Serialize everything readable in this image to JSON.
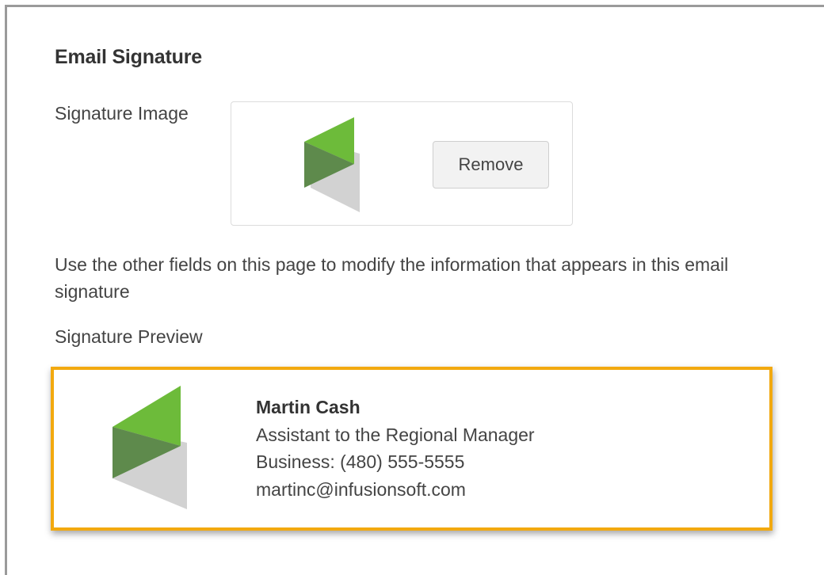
{
  "section": {
    "title": "Email Signature",
    "signature_image_label": "Signature Image",
    "remove_button_label": "Remove",
    "helper_text": "Use the other fields on this page to modify the information that appears in this email signature",
    "preview_label": "Signature Preview"
  },
  "preview": {
    "name": "Martin Cash",
    "title": "Assistant to the Regional Manager",
    "phone": "Business: (480) 555-5555",
    "email": "martinc@infusionsoft.com"
  },
  "colors": {
    "logo_green": "#6dbb3a",
    "logo_dark_green": "#5a8a4a",
    "logo_gray": "#cfcfcf",
    "highlight_border": "#f2a90f"
  },
  "icons": {
    "logo": "infusionsoft-logo-icon"
  }
}
